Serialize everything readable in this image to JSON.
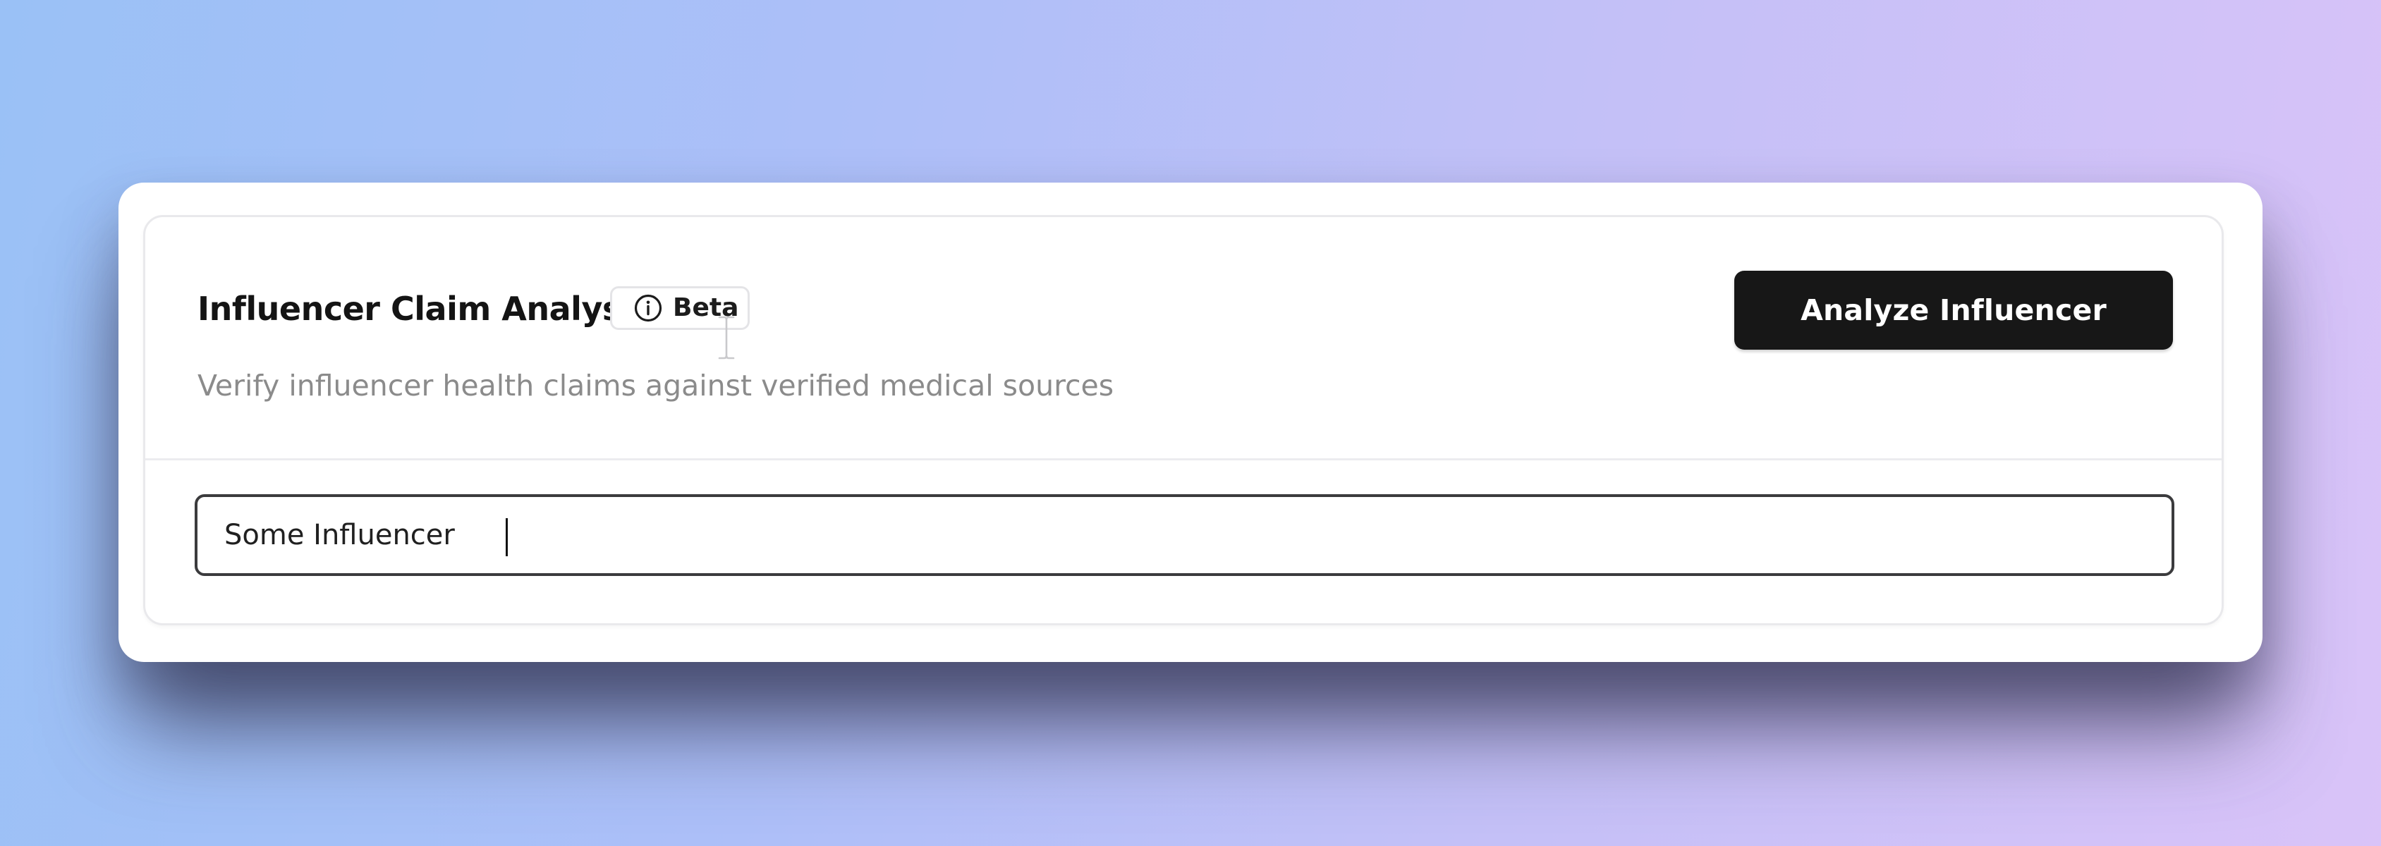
{
  "card": {
    "title": "Influencer Claim Analysis",
    "badge": {
      "icon": "info-icon",
      "label": "Beta"
    },
    "subtitle": "Verify influencer health claims against verified medical sources",
    "analyze_button_label": "Analyze Influencer",
    "search": {
      "value": "Some Influencer",
      "placeholder": ""
    }
  },
  "colors": {
    "button_bg": "#171717",
    "button_text": "#ffffff",
    "subtitle_text": "#8b8b8b",
    "input_border": "#3b3b3d"
  }
}
